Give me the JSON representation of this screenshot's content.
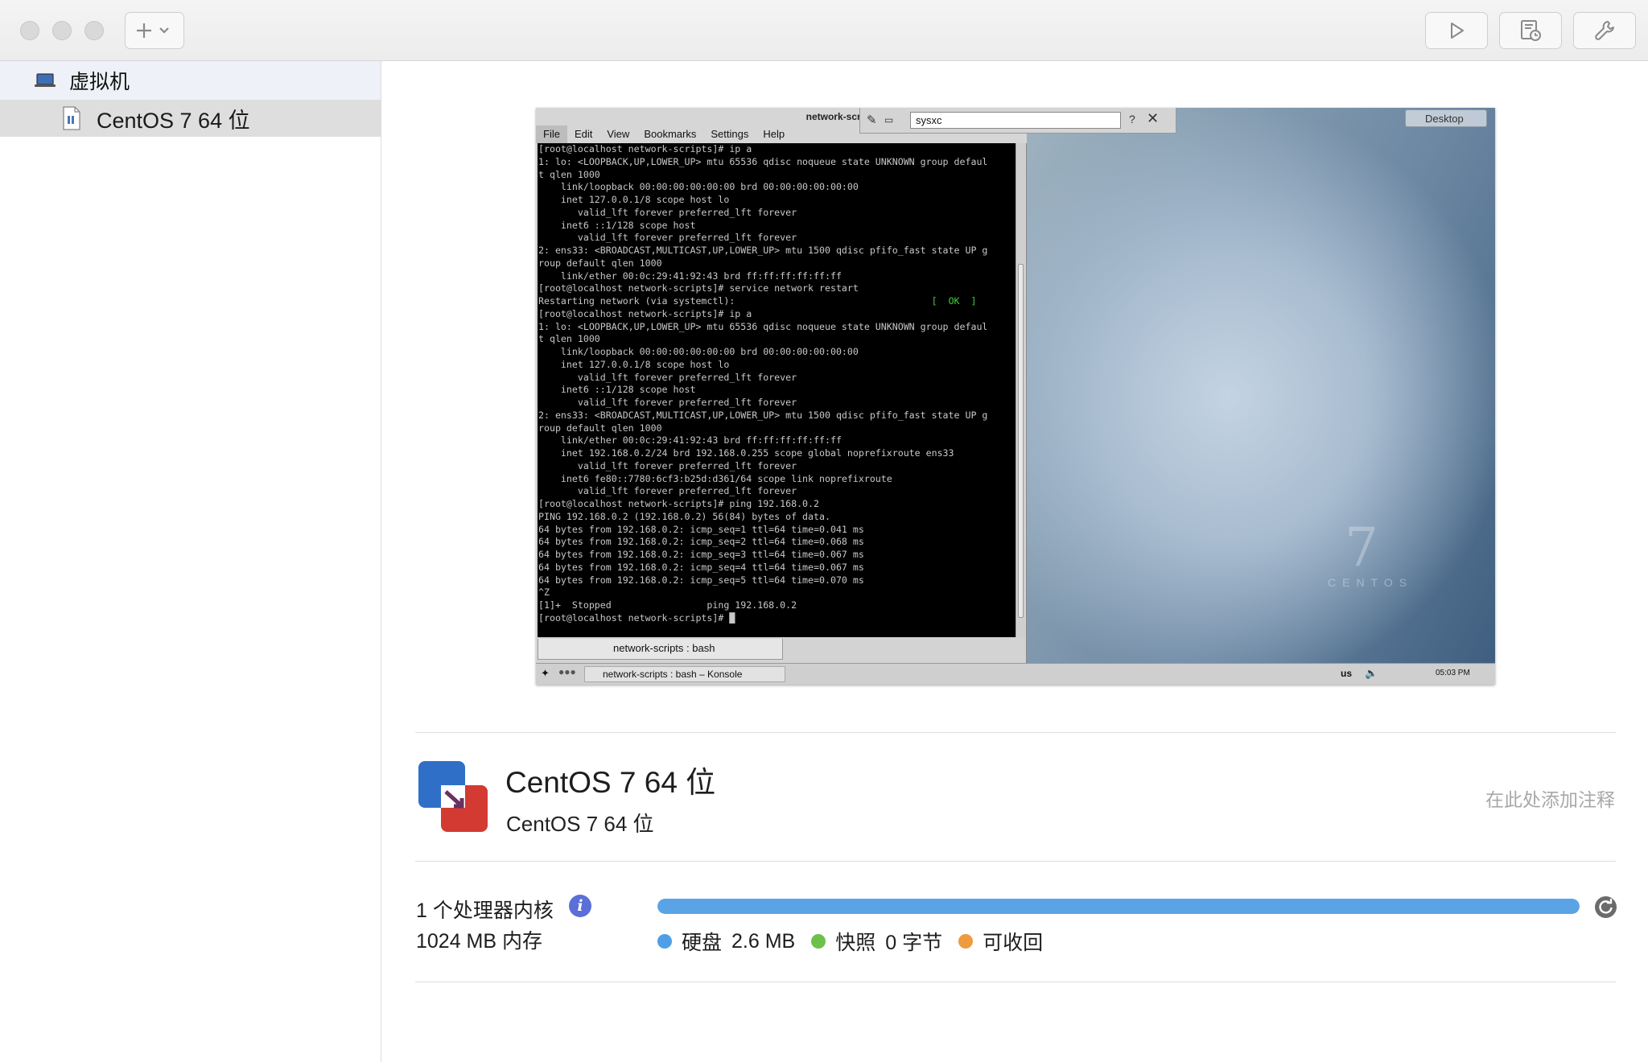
{
  "sidebar": {
    "group_label": "虚拟机",
    "items": [
      {
        "label": "CentOS 7 64 位"
      }
    ]
  },
  "toolbar": {
    "add_icon": "plus-chevron-icon",
    "run_icon": "play-icon",
    "snapshot_icon": "snapshot-icon",
    "settings_icon": "wrench-icon"
  },
  "vm_screen": {
    "konsole": {
      "title": "network-scripts : bash – Konso",
      "menu": [
        "File",
        "Edit",
        "View",
        "Bookmarks",
        "Settings",
        "Help"
      ],
      "search_value": "sysxc",
      "tab_label": "network-scripts : bash",
      "terminal_lines": [
        "[root@localhost network-scripts]# ip a",
        "1: lo: <LOOPBACK,UP,LOWER_UP> mtu 65536 qdisc noqueue state UNKNOWN group defaul",
        "t qlen 1000",
        "    link/loopback 00:00:00:00:00:00 brd 00:00:00:00:00:00",
        "    inet 127.0.0.1/8 scope host lo",
        "       valid_lft forever preferred_lft forever",
        "    inet6 ::1/128 scope host",
        "       valid_lft forever preferred_lft forever",
        "2: ens33: <BROADCAST,MULTICAST,UP,LOWER_UP> mtu 1500 qdisc pfifo_fast state UP g",
        "roup default qlen 1000",
        "    link/ether 00:0c:29:41:92:43 brd ff:ff:ff:ff:ff:ff",
        "[root@localhost network-scripts]# service network restart",
        "Restarting network (via systemctl):",
        "[root@localhost network-scripts]# ip a",
        "1: lo: <LOOPBACK,UP,LOWER_UP> mtu 65536 qdisc noqueue state UNKNOWN group defaul",
        "t qlen 1000",
        "    link/loopback 00:00:00:00:00:00 brd 00:00:00:00:00:00",
        "    inet 127.0.0.1/8 scope host lo",
        "       valid_lft forever preferred_lft forever",
        "    inet6 ::1/128 scope host",
        "       valid_lft forever preferred_lft forever",
        "2: ens33: <BROADCAST,MULTICAST,UP,LOWER_UP> mtu 1500 qdisc pfifo_fast state UP g",
        "roup default qlen 1000",
        "    link/ether 00:0c:29:41:92:43 brd ff:ff:ff:ff:ff:ff",
        "    inet 192.168.0.2/24 brd 192.168.0.255 scope global noprefixroute ens33",
        "       valid_lft forever preferred_lft forever",
        "    inet6 fe80::7780:6cf3:b25d:d361/64 scope link noprefixroute",
        "       valid_lft forever preferred_lft forever",
        "[root@localhost network-scripts]# ping 192.168.0.2",
        "PING 192.168.0.2 (192.168.0.2) 56(84) bytes of data.",
        "64 bytes from 192.168.0.2: icmp_seq=1 ttl=64 time=0.041 ms",
        "64 bytes from 192.168.0.2: icmp_seq=2 ttl=64 time=0.068 ms",
        "64 bytes from 192.168.0.2: icmp_seq=3 ttl=64 time=0.067 ms",
        "64 bytes from 192.168.0.2: icmp_seq=4 ttl=64 time=0.067 ms",
        "64 bytes from 192.168.0.2: icmp_seq=5 ttl=64 time=0.070 ms",
        "^Z",
        "[1]+  Stopped                 ping 192.168.0.2",
        "[root@localhost network-scripts]# "
      ],
      "ok_text": "[  OK  ]"
    },
    "desktop_button": "Desktop",
    "centos_number": "7",
    "centos_word": "CENTOS",
    "taskbar": {
      "task_label": "network-scripts : bash – Konsole",
      "keyboard": "us",
      "clock": "05:03 PM"
    }
  },
  "vm_info": {
    "name": "CentOS 7 64 位",
    "os": "CentOS 7 64 位",
    "note_placeholder": "在此处添加注释"
  },
  "specs": {
    "cpu": "1 个处理器内核",
    "memory": "1024 MB 内存"
  },
  "storage": {
    "fill_fraction": 1.0,
    "colors": {
      "disk": "#4f9fe6",
      "snapshot": "#6cc14a",
      "reclaimable": "#ef9a3f",
      "bar": "#5aa4e5"
    },
    "legend": [
      {
        "label": "硬盘",
        "value": "2.6 MB"
      },
      {
        "label": "快照",
        "value": "0 字节"
      },
      {
        "label": "可收回",
        "value": ""
      }
    ]
  }
}
